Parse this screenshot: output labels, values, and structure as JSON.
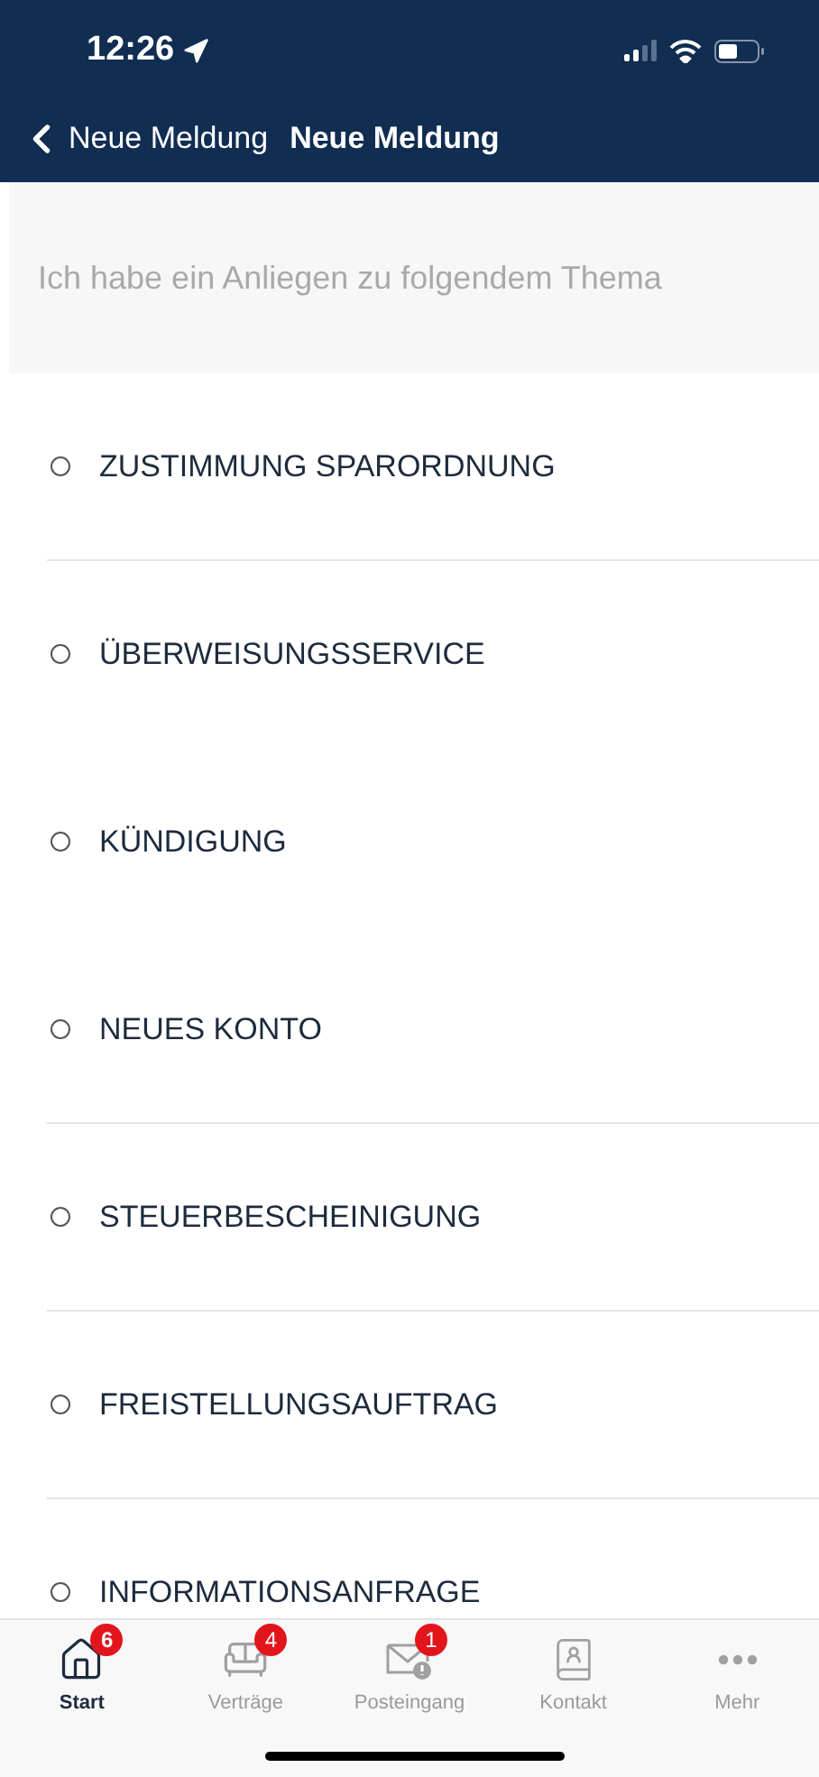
{
  "status_bar": {
    "time": "12:26"
  },
  "nav": {
    "back_label": "Neue Meldung",
    "title": "Neue Meldung"
  },
  "prompt": "Ich habe ein Anliegen zu folgendem Thema",
  "topics": [
    {
      "label": "ZUSTIMMUNG SPARORDNUNG",
      "selected": false,
      "divider": true
    },
    {
      "label": "ÜBERWEISUNGSSERVICE",
      "selected": false,
      "divider": false
    },
    {
      "label": "KÜNDIGUNG",
      "selected": false,
      "divider": false
    },
    {
      "label": "NEUES KONTO",
      "selected": false,
      "divider": true
    },
    {
      "label": "STEUERBESCHEINIGUNG",
      "selected": false,
      "divider": true
    },
    {
      "label": "FREISTELLUNGSAUFTRAG",
      "selected": false,
      "divider": true
    },
    {
      "label": "INFORMATIONSANFRAGE",
      "selected": false
    }
  ],
  "tabs": [
    {
      "label": "Start",
      "badge": "6",
      "selected": true
    },
    {
      "label": "Verträge",
      "badge": "4",
      "selected": false
    },
    {
      "label": "Posteingang",
      "badge": "1",
      "selected": false
    },
    {
      "label": "Kontakt",
      "selected": false
    },
    {
      "label": "Mehr",
      "selected": false
    }
  ]
}
